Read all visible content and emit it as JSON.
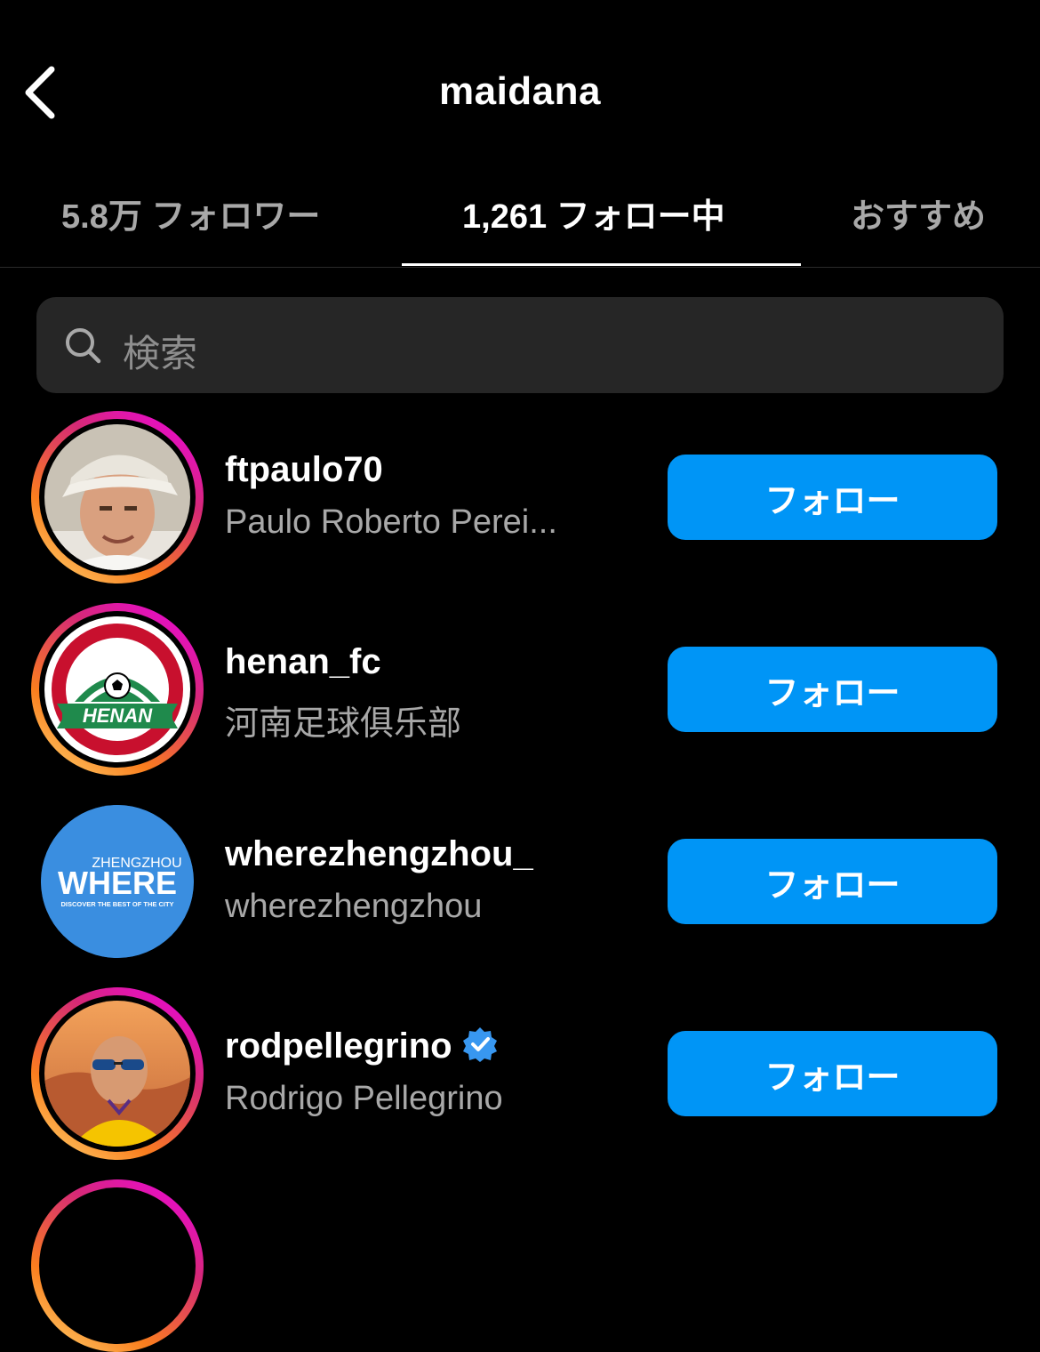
{
  "header": {
    "title": "maidana",
    "back_icon": "chevron-left-icon"
  },
  "tabs": [
    {
      "label": "5.8万 フォロワー",
      "active": false
    },
    {
      "label": "1,261 フォロー中",
      "active": true
    },
    {
      "label": "おすすめ",
      "active": false
    }
  ],
  "search": {
    "placeholder": "検索",
    "icon": "search-icon"
  },
  "users": [
    {
      "username": "ftpaulo70",
      "full_name": "Paulo Roberto Perei...",
      "verified": false,
      "story_ring": true,
      "button": "フォロー"
    },
    {
      "username": "henan_fc",
      "full_name": "河南足球俱乐部",
      "verified": false,
      "story_ring": true,
      "button": "フォロー",
      "logo_text": "HENAN"
    },
    {
      "username": "wherezhengzhou_",
      "full_name": "wherezhengzhou",
      "verified": false,
      "story_ring": false,
      "button": "フォロー",
      "logo_text_top": "ZHENGZHOU",
      "logo_text_main": "WHERE",
      "logo_text_sub": "DISCOVER THE BEST OF THE CITY"
    },
    {
      "username": "rodpellegrino",
      "full_name": "Rodrigo Pellegrino",
      "verified": true,
      "story_ring": true,
      "button": "フォロー"
    }
  ],
  "colors": {
    "background": "#000000",
    "follow_button": "#0095f6",
    "secondary_text": "#a8a8a8",
    "search_bg": "#262626",
    "verified": "#3897f0"
  }
}
